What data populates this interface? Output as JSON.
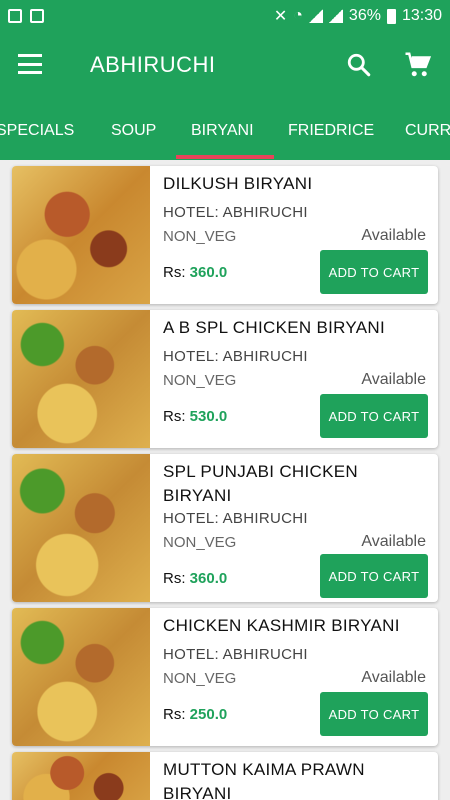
{
  "status_bar": {
    "battery": "36%",
    "time": "13:30"
  },
  "app": {
    "title": "ABHIRUCHI"
  },
  "tabs": [
    {
      "label": "SPECIALS"
    },
    {
      "label": "SOUP"
    },
    {
      "label": "BIRYANI",
      "selected": true
    },
    {
      "label": "FRIEDRICE"
    },
    {
      "label": "CURRI"
    }
  ],
  "colors": {
    "primary": "#1fa25b",
    "indicator": "#e8435a"
  },
  "items": [
    {
      "name": "DILKUSH BIRYANI",
      "hotel": "HOTEL: ABHIRUCHI",
      "type": "NON_VEG",
      "status": "Available",
      "currency": "Rs:",
      "price": "360.0",
      "button": "ADD TO CART"
    },
    {
      "name": "A B SPL CHICKEN BIRYANI",
      "hotel": "HOTEL: ABHIRUCHI",
      "type": "NON_VEG",
      "status": "Available",
      "currency": "Rs:",
      "price": "530.0",
      "button": "ADD TO CART"
    },
    {
      "name": "SPL PUNJABI CHICKEN BIRYANI",
      "hotel": "HOTEL: ABHIRUCHI",
      "type": "NON_VEG",
      "status": "Available",
      "currency": "Rs:",
      "price": "360.0",
      "button": "ADD TO CART"
    },
    {
      "name": "CHICKEN KASHMIR BIRYANI",
      "hotel": "HOTEL: ABHIRUCHI",
      "type": "NON_VEG",
      "status": "Available",
      "currency": "Rs:",
      "price": "250.0",
      "button": "ADD TO CART"
    },
    {
      "name": "MUTTON KAIMA PRAWN BIRYANI"
    }
  ]
}
